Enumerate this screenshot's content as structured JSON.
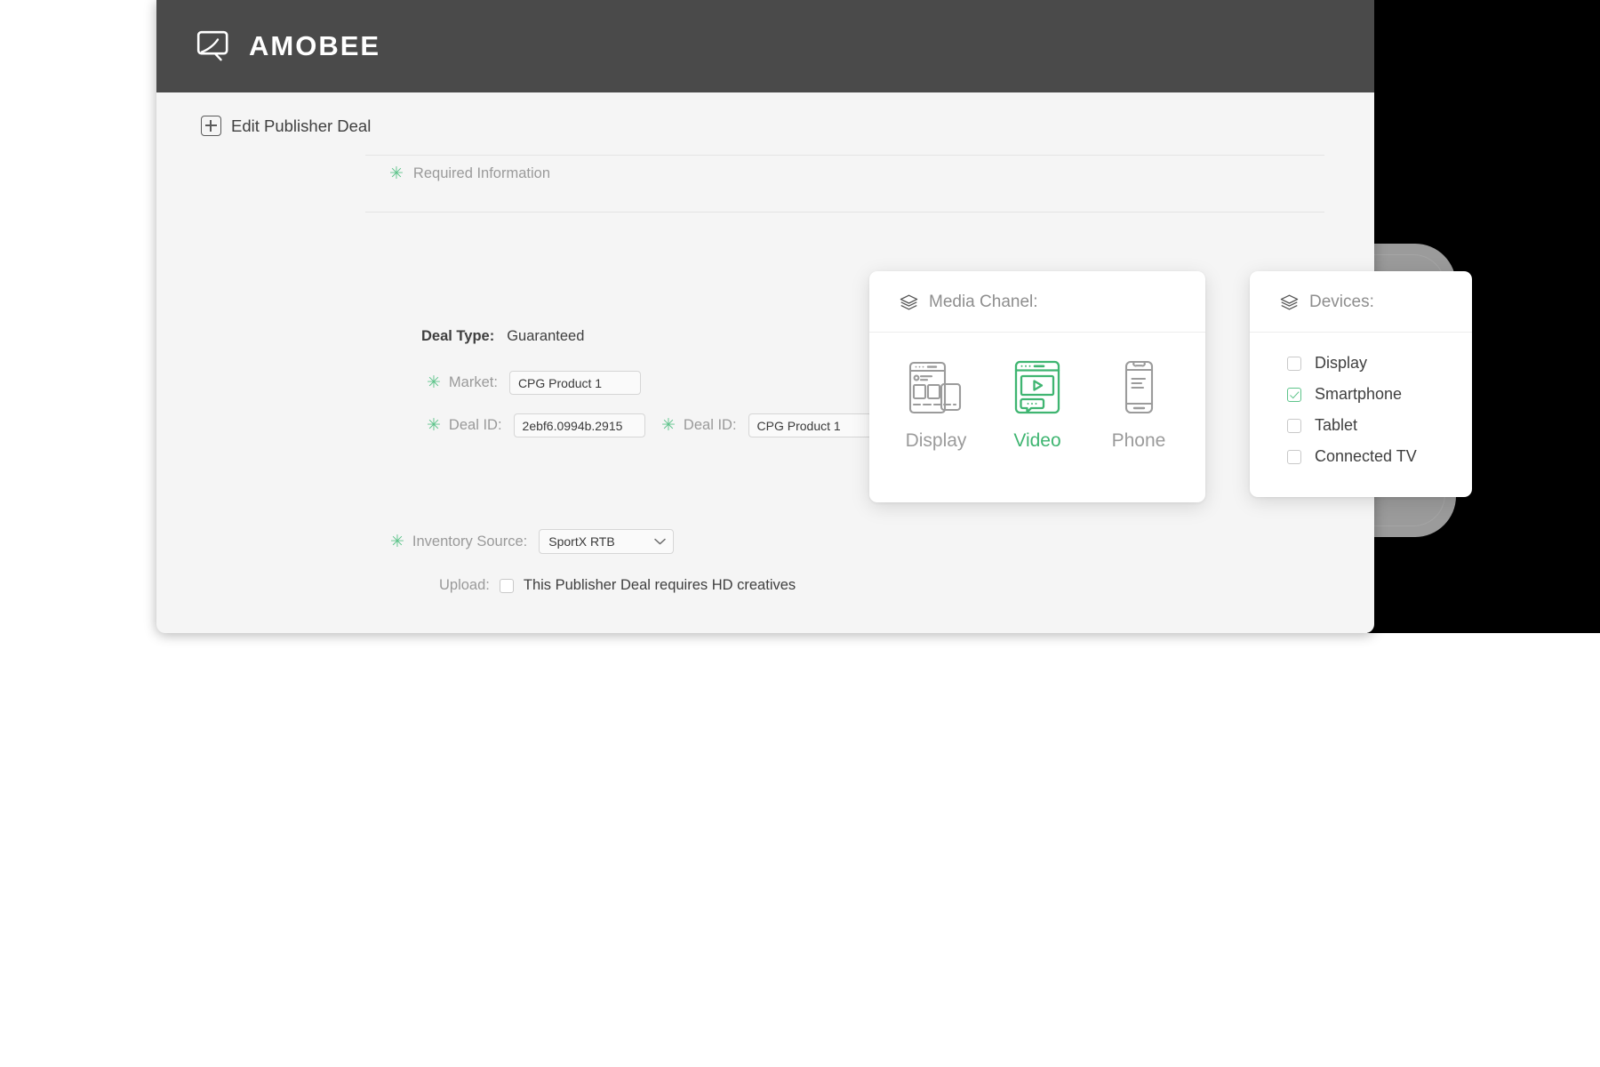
{
  "header": {
    "brand": "AMOBEE",
    "logo_icon": "monitor-icon"
  },
  "page": {
    "title": "Edit Publisher Deal",
    "expand_icon": "plus-square-icon"
  },
  "required_section": {
    "label": "Required Information",
    "asterisk": "✳"
  },
  "form": {
    "deal_type": {
      "label": "Deal Type:",
      "value": "Guaranteed"
    },
    "market": {
      "label": "Market:",
      "value": "CPG Product 1",
      "required": true
    },
    "deal_id_1": {
      "label": "Deal ID:",
      "value": "2ebf6.0994b.2915",
      "required": true
    },
    "deal_id_2": {
      "label": "Deal ID:",
      "value": "CPG Product 1",
      "required": true
    },
    "inventory_source": {
      "label": "Inventory Source:",
      "value": "SportX RTB",
      "required": true,
      "options": [
        "SportX RTB"
      ]
    },
    "upload": {
      "label": "Upload:",
      "checkbox_label": "This Publisher Deal requires HD creatives",
      "checked": false
    }
  },
  "media_panel": {
    "title": "Media Chanel:",
    "icon": "layers-icon",
    "items": [
      {
        "label": "Display",
        "icon": "display-browser-icon",
        "selected": false
      },
      {
        "label": "Video",
        "icon": "video-browser-icon",
        "selected": true
      },
      {
        "label": "Phone",
        "icon": "smartphone-icon",
        "selected": false
      }
    ]
  },
  "devices_panel": {
    "title": "Devices:",
    "icon": "layers-icon",
    "items": [
      {
        "label": "Display",
        "checked": false
      },
      {
        "label": "Smartphone",
        "checked": true
      },
      {
        "label": "Tablet",
        "checked": false
      },
      {
        "label": "Connected TV",
        "checked": false
      }
    ]
  },
  "colors": {
    "accent_green": "#3fb571",
    "header_dark": "#4a4a4a",
    "card_bg": "#f5f5f5",
    "backdrop_black": "#000000",
    "device_gray": "#9b9b9b"
  }
}
